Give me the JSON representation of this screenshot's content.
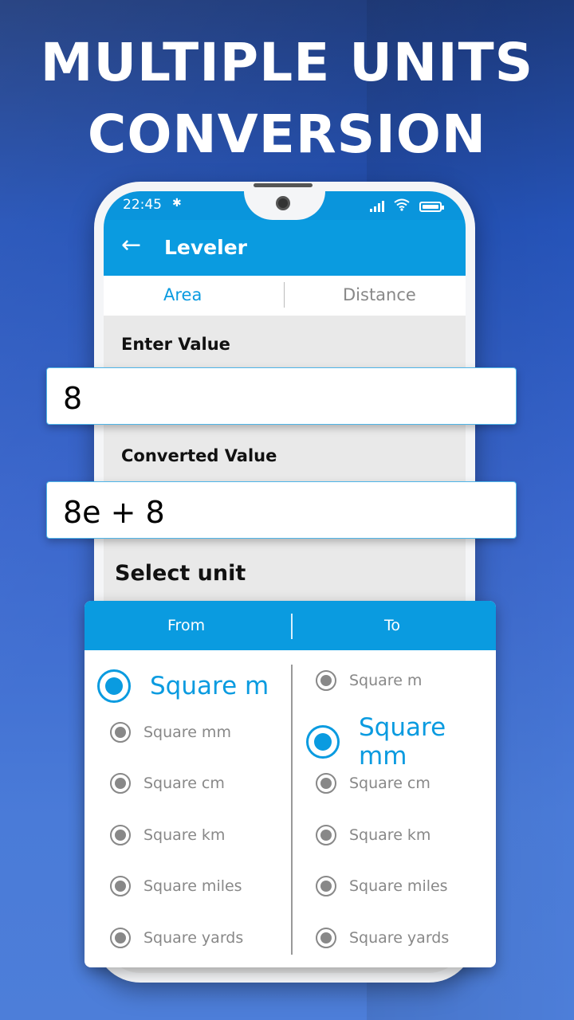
{
  "headline": {
    "line1": "MULTIPLE UNITS",
    "line2": "CONVERSION"
  },
  "status_bar": {
    "time": "22:45",
    "icons": [
      "bluetooth-icon",
      "signal-icon",
      "wifi-icon",
      "battery-icon"
    ]
  },
  "app_bar": {
    "back_icon": "←",
    "title": "Leveler"
  },
  "tabs": [
    {
      "label": "Area",
      "active": true
    },
    {
      "label": "Distance",
      "active": false
    }
  ],
  "form": {
    "enter_label": "Enter Value",
    "input_value": "8",
    "converted_label": "Converted Value",
    "converted_value": "8e + 8",
    "select_label": "Select unit"
  },
  "unit_panel": {
    "from_label": "From",
    "to_label": "To",
    "from_options": [
      "Square m",
      "Square mm",
      "Square cm",
      "Square km",
      "Square miles",
      "Square yards"
    ],
    "from_selected": "Square m",
    "to_options": [
      "Square m",
      "Square mm",
      "Square cm",
      "Square km",
      "Square miles",
      "Square yards"
    ],
    "to_selected": "Square mm"
  },
  "colors": {
    "accent": "#0a9be0",
    "background": "#2f5fc4",
    "muted_text": "#888888"
  }
}
